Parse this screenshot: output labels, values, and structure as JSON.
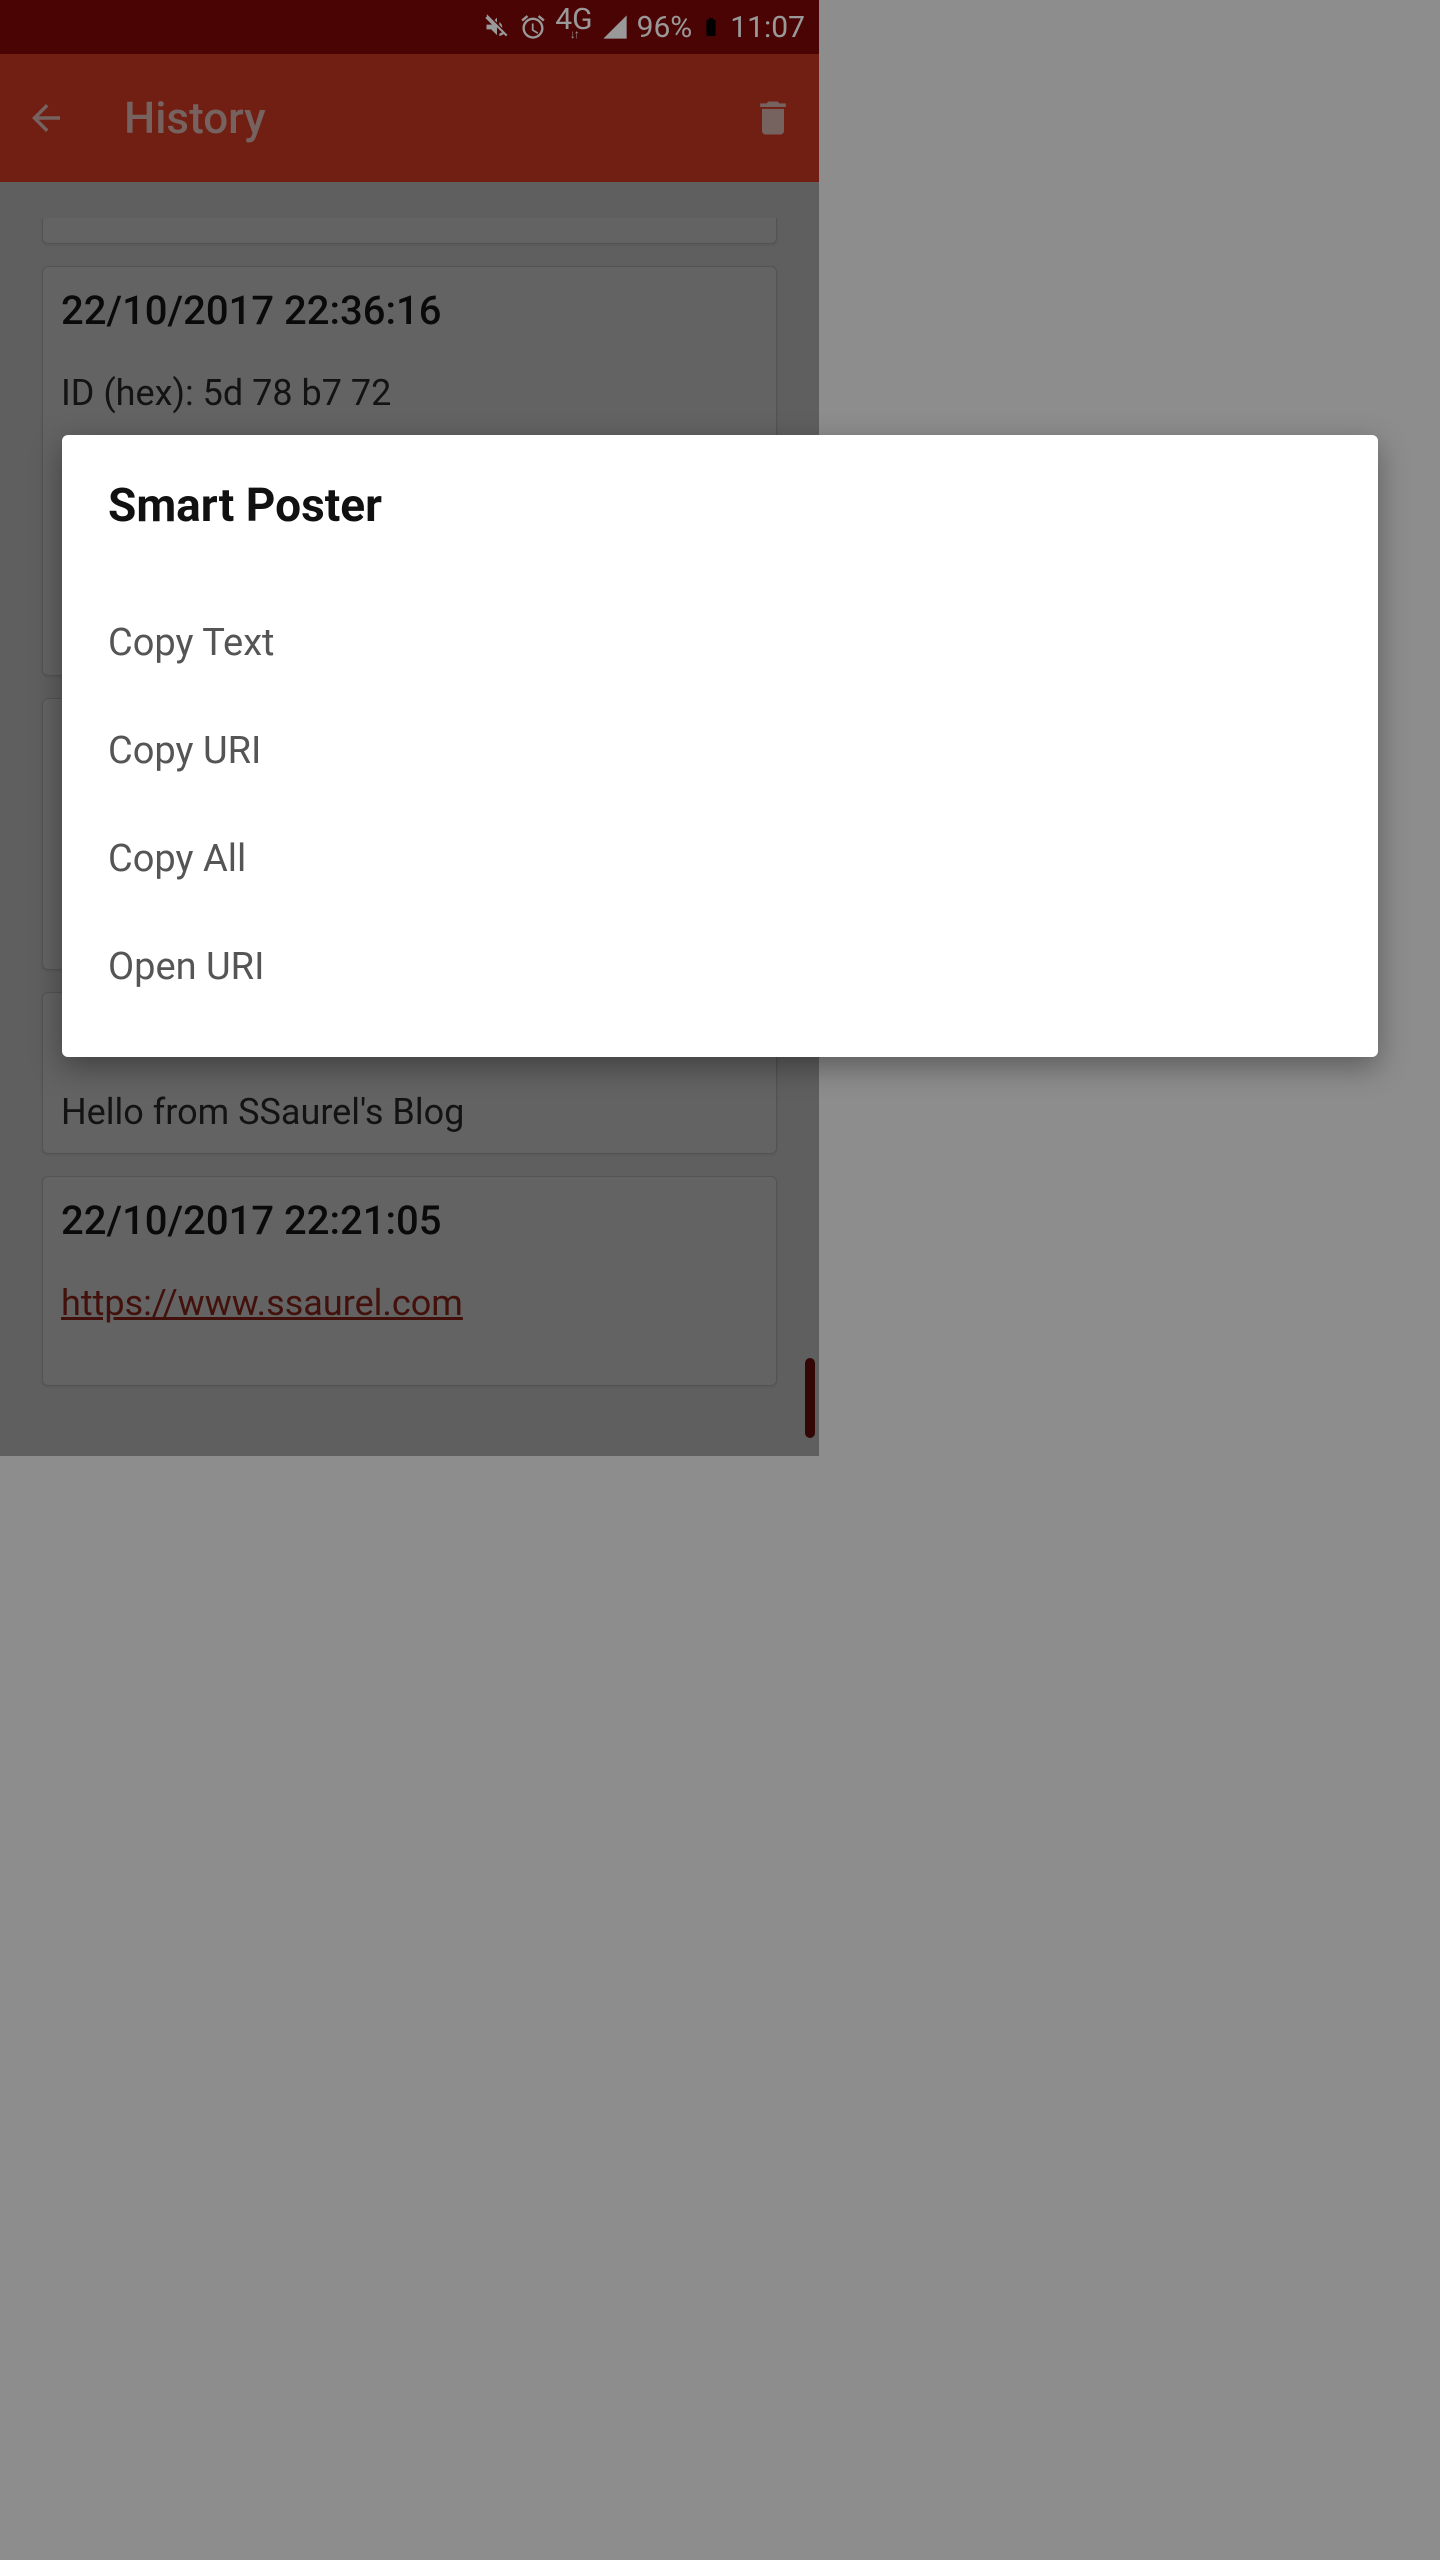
{
  "status_bar": {
    "network_label": "4G",
    "battery_pct": "96%",
    "time": "11:07"
  },
  "app_bar": {
    "title": "History"
  },
  "cards": [
    {
      "ts": "22/10/2017  22:36:16",
      "id_line": "ID (hex): 5d 78 b7 72"
    },
    {
      "ts": "",
      "text": "Hello from SSaurel's Blog"
    },
    {
      "ts": "22/10/2017  22:21:05",
      "link": "https://www.ssaurel.com"
    }
  ],
  "dialog": {
    "title": "Smart Poster",
    "items": [
      "Copy Text",
      "Copy URI",
      "Copy All",
      "Open URI"
    ]
  }
}
